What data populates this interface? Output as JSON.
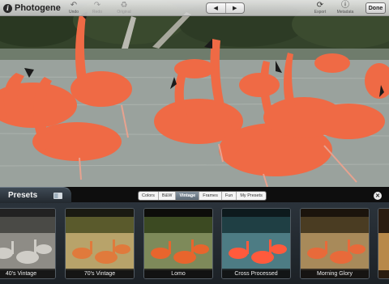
{
  "app": {
    "title": "Photogene",
    "icon_letter": "i"
  },
  "toolbar": {
    "undo_label": "Undo",
    "redo_label": "Redo",
    "original_label": "Original",
    "prev_arrow": "◀",
    "next_arrow": "▶",
    "export_label": "Export",
    "metadata_label": "Metadata",
    "done_label": "Done"
  },
  "presets": {
    "title": "Presets",
    "tabs": [
      "Colors",
      "B&W",
      "Vintage",
      "Frames",
      "Fun",
      "My Presets"
    ],
    "active_tab": "Vintage",
    "close_glyph": "✕",
    "items": [
      {
        "label": "40's Vintage",
        "tint": "#9a9791"
      },
      {
        "label": "70's Vintage",
        "tint": "#b99a4f"
      },
      {
        "label": "Lomo",
        "tint": "#7f8a55"
      },
      {
        "label": "Cross Processed",
        "tint": "#3f6f78"
      },
      {
        "label": "Morning Glory",
        "tint": "#9a7a47"
      }
    ]
  },
  "colors": {
    "flamingo": "#ef6a45",
    "water": "#9aa29d",
    "panel": "#23292f"
  }
}
